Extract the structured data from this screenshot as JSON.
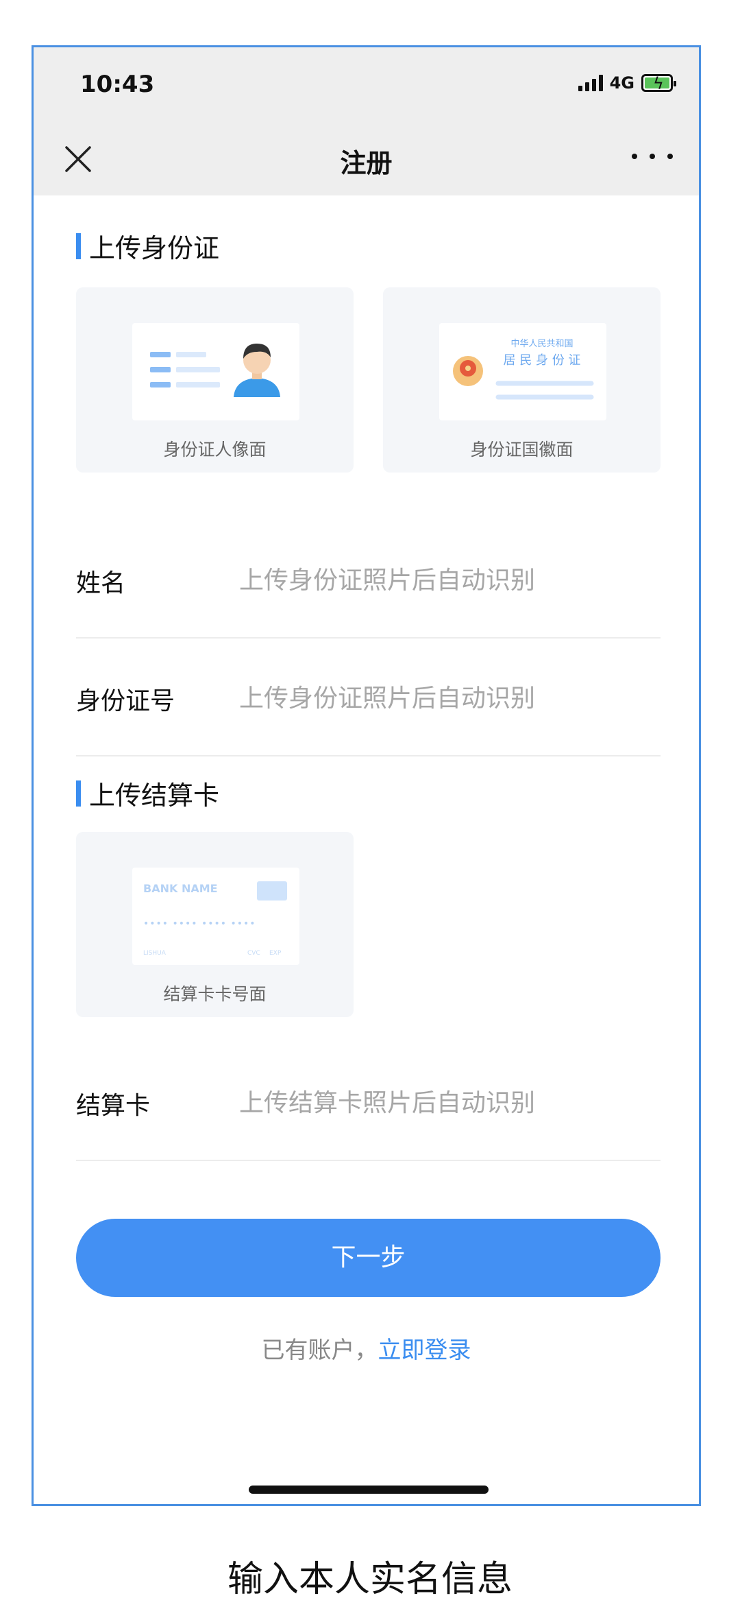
{
  "status_bar": {
    "time": "10:43",
    "network": "4G"
  },
  "navbar": {
    "title": "注册"
  },
  "sections": {
    "id_card": {
      "title": "上传身份证"
    },
    "settlement": {
      "title": "上传结算卡"
    }
  },
  "cards": {
    "portrait": {
      "label": "身份证人像面"
    },
    "emblem": {
      "label": "身份证国徽面",
      "line1": "中华人民共和国",
      "line2": "居 民 身 份 证"
    },
    "bank": {
      "label": "结算卡卡号面",
      "bank_name": "BANK NAME",
      "number": "•••• •••• •••• ••••",
      "brand": "LISHUA",
      "cvc": "CVC",
      "exp": "EXP"
    }
  },
  "fields": {
    "name": {
      "label": "姓名",
      "value": "上传身份证照片后自动识别"
    },
    "id_number": {
      "label": "身份证号",
      "value": "上传身份证照片后自动识别"
    },
    "card": {
      "label": "结算卡",
      "value": "上传结算卡照片后自动识别"
    }
  },
  "actions": {
    "next": "下一步",
    "login_prompt": "已有账户，",
    "login_link": "立即登录"
  },
  "caption": "输入本人实名信息",
  "colors": {
    "accent": "#4390f3",
    "border": "#4a90e2",
    "header_bg": "#eeeeee"
  }
}
